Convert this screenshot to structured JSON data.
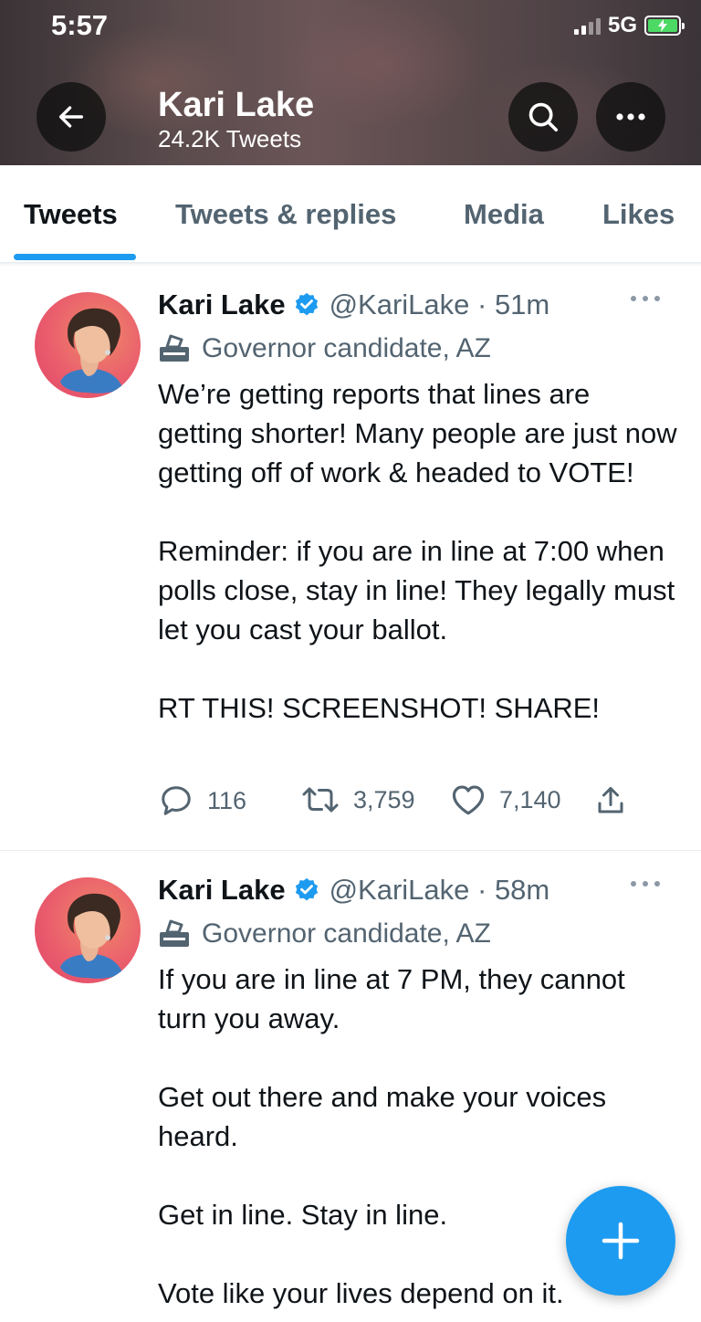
{
  "status_bar": {
    "time": "5:57",
    "network": "5G"
  },
  "header": {
    "name": "Kari Lake",
    "tweet_count": "24.2K Tweets"
  },
  "tabs": [
    {
      "label": "Tweets",
      "active": true
    },
    {
      "label": "Tweets & replies",
      "active": false
    },
    {
      "label": "Media",
      "active": false
    },
    {
      "label": "Likes",
      "active": false
    }
  ],
  "colors": {
    "accent": "#1d9bf0",
    "text": "#0f1419",
    "muted": "#536471"
  },
  "tweets": [
    {
      "name": "Kari Lake",
      "handle": "@KariLake · 51m",
      "label": "Governor candidate, AZ",
      "paragraphs": [
        "We’re getting reports that lines are getting shorter! Many people are just now getting off of work & headed to VOTE!",
        "Reminder: if you are in line at 7:00 when polls close, stay in line! They legally must let you cast your ballot.",
        "RT THIS! SCREENSHOT! SHARE!"
      ],
      "replies": "116",
      "retweets": "3,759",
      "likes": "7,140"
    },
    {
      "name": "Kari Lake",
      "handle": "@KariLake · 58m",
      "label": "Governor candidate, AZ",
      "paragraphs": [
        "If you are in line at 7 PM, they cannot turn you away.",
        "Get out there and make your voices heard.",
        "Get in line. Stay in line.",
        "Vote like your lives depend on it."
      ]
    }
  ],
  "icons": {
    "back": "arrow-left-icon",
    "search": "search-icon",
    "more": "more-icon",
    "verified": "verified-badge-icon",
    "label": "ballot-box-icon",
    "reply": "reply-icon",
    "retweet": "retweet-icon",
    "like": "heart-icon",
    "share": "share-icon",
    "compose": "plus-icon"
  }
}
